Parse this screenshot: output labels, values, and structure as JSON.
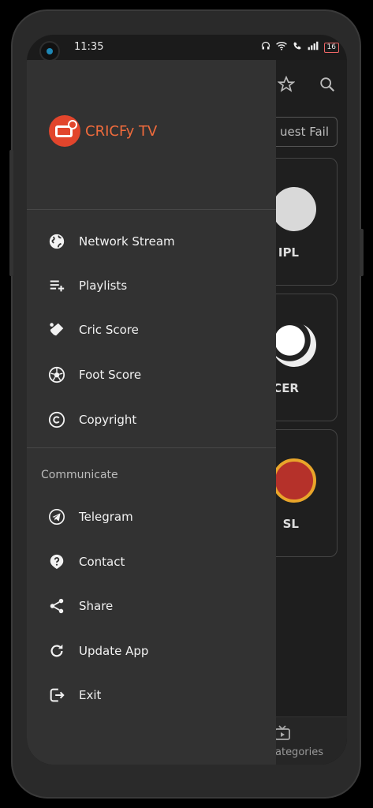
{
  "status_bar": {
    "time": "11:35",
    "battery": "16"
  },
  "brand": {
    "name": "CRICFy TV"
  },
  "menu": [
    {
      "label": "Network Stream",
      "icon": "globe-icon"
    },
    {
      "label": "Playlists",
      "icon": "playlist-add-icon"
    },
    {
      "label": "Cric Score",
      "icon": "cricket-icon"
    },
    {
      "label": "Foot Score",
      "icon": "football-icon"
    },
    {
      "label": "Copyright",
      "icon": "copyright-icon"
    }
  ],
  "communicate": {
    "title": "Communicate",
    "items": [
      {
        "label": "Telegram",
        "icon": "telegram-icon"
      },
      {
        "label": "Contact",
        "icon": "help-icon"
      },
      {
        "label": "Share",
        "icon": "share-icon"
      },
      {
        "label": "Update App",
        "icon": "refresh-icon"
      },
      {
        "label": "Exit",
        "icon": "exit-icon"
      }
    ]
  },
  "background": {
    "error_text": "uest Fail",
    "cards": [
      {
        "label": "IPL"
      },
      {
        "label": "OCCER"
      },
      {
        "label": "SL"
      }
    ],
    "bottom_tab": "ategories"
  },
  "colors": {
    "accent": "#f06b3c",
    "drawer": "#323232"
  }
}
